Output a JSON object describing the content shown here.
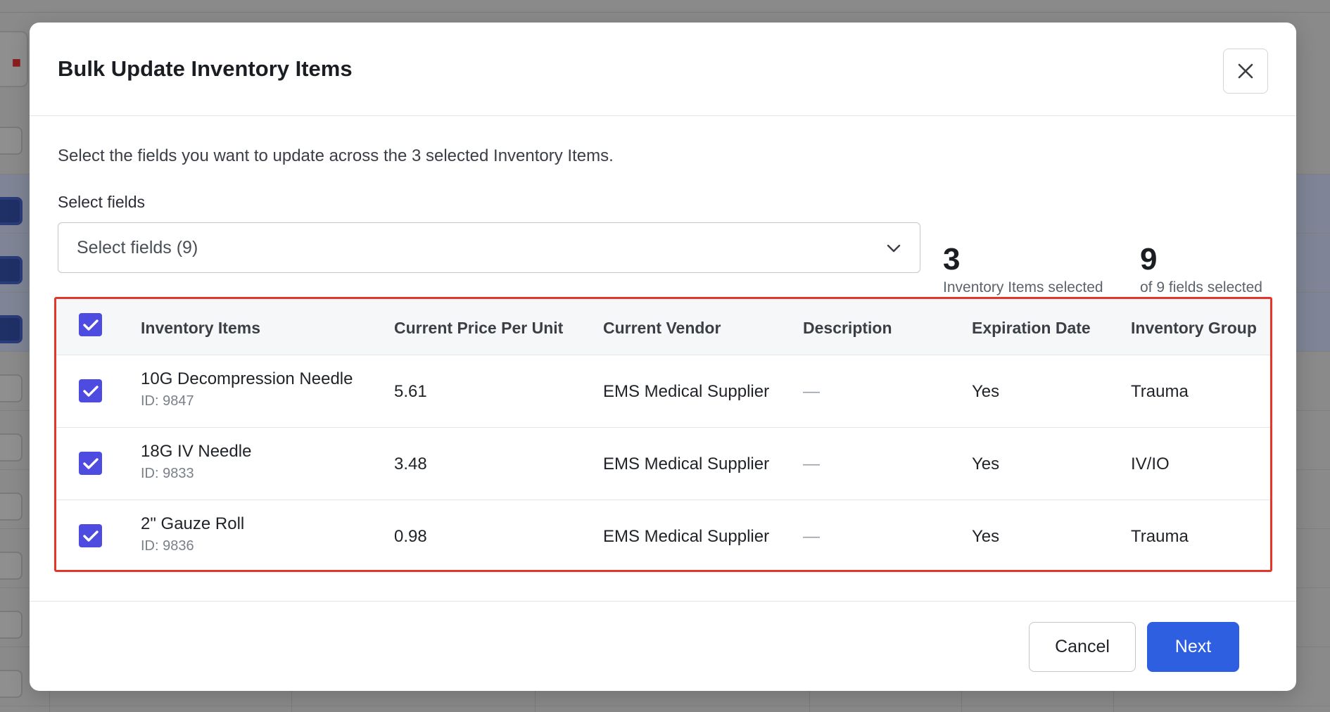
{
  "modal": {
    "title": "Bulk Update Inventory Items",
    "intro": "Select the fields you want to update across the 3 selected Inventory Items.",
    "select_label": "Select fields",
    "select_value": "Select fields (9)",
    "stats": [
      {
        "number": "3",
        "caption": "Inventory Items selected"
      },
      {
        "number": "9",
        "caption": "of 9 fields selected"
      }
    ]
  },
  "table": {
    "headers": [
      "Inventory Items",
      "Current Price Per Unit",
      "Current Vendor",
      "Description",
      "Expiration Date",
      "Inventory Group"
    ],
    "header_checkbox_checked": true,
    "rows": [
      {
        "checked": true,
        "name": "10G Decompression Needle",
        "id": "ID: 9847",
        "price": "5.61",
        "vendor": "EMS Medical Supplier",
        "description": "—",
        "expiration": "Yes",
        "group": "Trauma"
      },
      {
        "checked": true,
        "name": "18G IV Needle",
        "id": "ID: 9833",
        "price": "3.48",
        "vendor": "EMS Medical Supplier",
        "description": "—",
        "expiration": "Yes",
        "group": "IV/IO"
      },
      {
        "checked": true,
        "name": "2\" Gauze Roll",
        "id": "ID: 9836",
        "price": "0.98",
        "vendor": "EMS Medical Supplier",
        "description": "—",
        "expiration": "Yes",
        "group": "Trauma"
      }
    ]
  },
  "footer": {
    "cancel_label": "Cancel",
    "next_label": "Next"
  },
  "colors": {
    "accent": "#2d5fe0",
    "checkbox": "#4d4be0",
    "highlight_border": "#e5362b"
  },
  "icons": {
    "close": "close-icon",
    "chevron": "chevron-down-icon",
    "check": "checkmark-icon",
    "trash": "trash-icon"
  }
}
